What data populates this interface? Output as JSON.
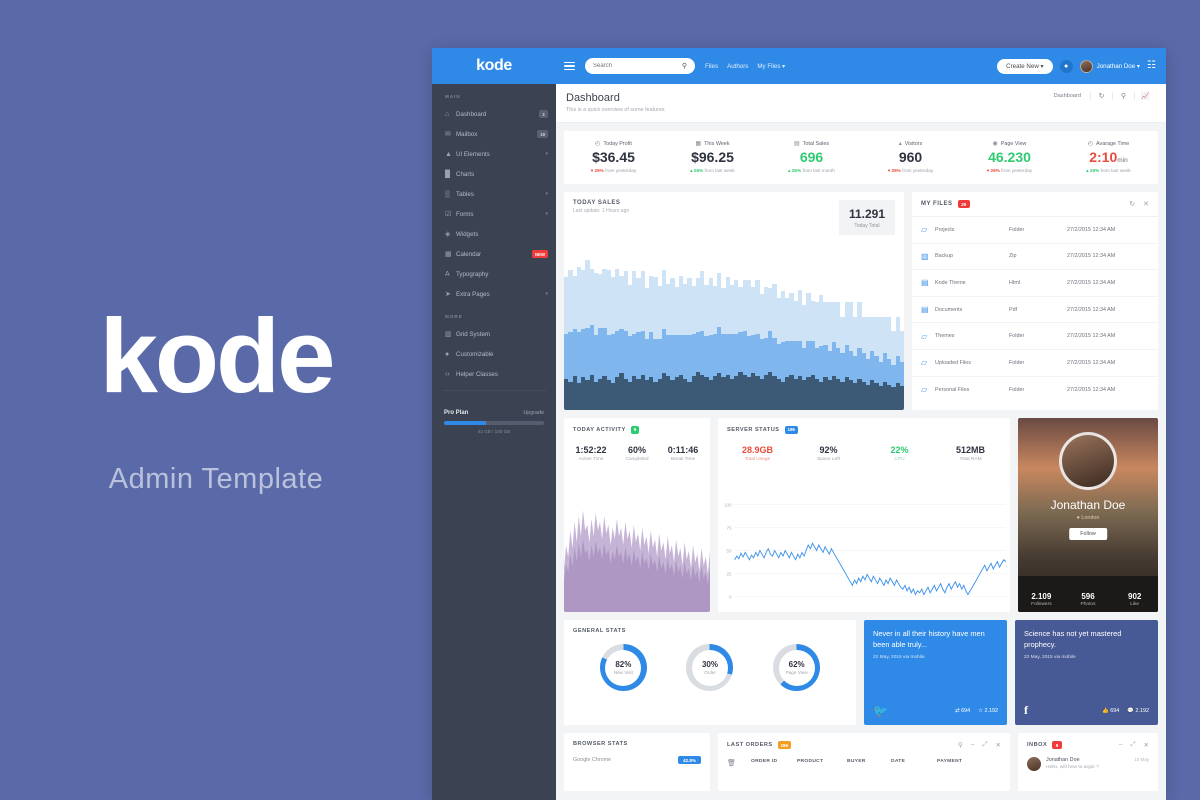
{
  "brand": {
    "logo": "kode",
    "tagline": "Admin Template",
    "accent": "#2e8ae6",
    "page_bg": "#5a6aa8"
  },
  "sidebar": {
    "logo": "kode",
    "section_main": "MAIN",
    "section_more": "MORE",
    "items_main": [
      {
        "label": "Dashboard",
        "icon": "home-icon",
        "badge": "3",
        "caret": ""
      },
      {
        "label": "Mailbox",
        "icon": "mail-icon",
        "badge": "19",
        "caret": ""
      },
      {
        "label": "UI Elements",
        "icon": "layers-icon",
        "badge": "",
        "caret": "▾"
      },
      {
        "label": "Charts",
        "icon": "chart-icon",
        "badge": "",
        "caret": ""
      },
      {
        "label": "Tables",
        "icon": "grid-icon",
        "badge": "",
        "caret": "▾"
      },
      {
        "label": "Forms",
        "icon": "form-icon",
        "badge": "",
        "caret": "▾"
      },
      {
        "label": "Widgets",
        "icon": "widget-icon",
        "badge": "",
        "caret": ""
      },
      {
        "label": "Calendar",
        "icon": "calendar-icon",
        "badge": "NEW",
        "caret": ""
      },
      {
        "label": "Typography",
        "icon": "type-icon",
        "badge": "",
        "caret": ""
      },
      {
        "label": "Extra Pages",
        "icon": "rocket-icon",
        "badge": "",
        "caret": "▾"
      }
    ],
    "items_more": [
      {
        "label": "Grid System",
        "icon": "columns-icon"
      },
      {
        "label": "Customizable",
        "icon": "bulb-icon"
      },
      {
        "label": "Helper Classes",
        "icon": "code-icon"
      }
    ],
    "plan": {
      "name": "Pro Plan",
      "upgrade": "Upgrade",
      "usage": "42 GB / 100 GB",
      "percent": 42
    }
  },
  "topbar": {
    "search_placeholder": "Search",
    "nav": [
      "Files",
      "Authors",
      "My Files ▾"
    ],
    "create_label": "Create New ▾",
    "user_name": "Jonathan Doe ▾"
  },
  "pagehead": {
    "title": "Dashboard",
    "subtitle": "This is a quick overview of some features",
    "breadcrumb": "Dashboard"
  },
  "stats": [
    {
      "label": "Today Profit",
      "icon": "clock-icon",
      "value": "$36.45",
      "unit": "",
      "color": "dark",
      "dir": "dn",
      "pct": "26%",
      "note": "from yesterday"
    },
    {
      "label": "This Week",
      "icon": "calendar-icon",
      "value": "$96.25",
      "unit": "",
      "color": "dark",
      "dir": "up",
      "pct": "26%",
      "note": "from last week"
    },
    {
      "label": "Total Sales",
      "icon": "cart-icon",
      "value": "696",
      "unit": "",
      "color": "green",
      "dir": "up",
      "pct": "26%",
      "note": "from last month"
    },
    {
      "label": "Visitors",
      "icon": "users-icon",
      "value": "960",
      "unit": "",
      "color": "dark",
      "dir": "dn",
      "pct": "26%",
      "note": "from yesterday"
    },
    {
      "label": "Page View",
      "icon": "eye-icon",
      "value": "46.230",
      "unit": "",
      "color": "green",
      "dir": "dn",
      "pct": "26%",
      "note": "from yesterday"
    },
    {
      "label": "Avarage Time",
      "icon": "clock-icon",
      "value": "2:10",
      "unit": "min",
      "color": "red",
      "dir": "up",
      "pct": "26%",
      "note": "from last week"
    }
  ],
  "today_sales": {
    "title": "TODAY SALES",
    "subtitle": "Last update: 1 Hours ago",
    "total": "11.291",
    "total_caption": "Today Total"
  },
  "my_files": {
    "title": "MY FILES",
    "badge": "29",
    "rows": [
      {
        "name": "Projects",
        "type": "Folder",
        "date": "27/2/2015 12:34 AM",
        "icon": "folder-icon"
      },
      {
        "name": "Backup",
        "type": "Zip",
        "date": "27/2/2015 12:34 AM",
        "icon": "zip-icon"
      },
      {
        "name": "Kode Theme",
        "type": "Html",
        "date": "27/2/2015 12:34 AM",
        "icon": "html-icon"
      },
      {
        "name": "Documents",
        "type": "Pdf",
        "date": "27/2/2015 12:34 AM",
        "icon": "pdf-icon"
      },
      {
        "name": "Themes",
        "type": "Folder",
        "date": "27/2/2015 12:34 AM",
        "icon": "folder-icon"
      },
      {
        "name": "Uploaded Files",
        "type": "Folder",
        "date": "27/2/2015 12:34 AM",
        "icon": "folder-icon"
      },
      {
        "name": "Personal Files",
        "type": "Folder",
        "date": "27/2/2015 12:34 AM",
        "icon": "folder-icon"
      }
    ]
  },
  "today_activity": {
    "title": "TODAY ACTIVITY",
    "badge": "9",
    "kpis": [
      {
        "value": "1:52:22",
        "caption": "Active Time"
      },
      {
        "value": "60%",
        "caption": "Completed"
      },
      {
        "value": "0:11:46",
        "caption": "Break Time"
      }
    ]
  },
  "server_status": {
    "title": "SERVER STATUS",
    "badge": "196",
    "kpis": [
      {
        "value": "28.9GB",
        "caption": "Total Usage",
        "color": "red"
      },
      {
        "value": "92%",
        "caption": "Space Left",
        "color": "dark"
      },
      {
        "value": "22%",
        "caption": "CPU",
        "color": "green"
      },
      {
        "value": "512MB",
        "caption": "Total RAM",
        "color": "dark"
      }
    ]
  },
  "profile": {
    "name": "Jonathan Doe",
    "location": "London",
    "follow_label": "Follow",
    "stats": [
      {
        "value": "2.109",
        "caption": "Followers"
      },
      {
        "value": "596",
        "caption": "Photos"
      },
      {
        "value": "902",
        "caption": "Like"
      }
    ]
  },
  "general_stats": {
    "title": "GENERAL STATS",
    "donuts": [
      {
        "percent": "82%",
        "caption": "New Visit",
        "value": 82,
        "color": "#2e8ae6"
      },
      {
        "percent": "30%",
        "caption": "Order",
        "value": 30,
        "color": "#2e8ae6"
      },
      {
        "percent": "62%",
        "caption": "Page View",
        "value": 62,
        "color": "#2e8ae6"
      }
    ]
  },
  "social": [
    {
      "network": "twitter",
      "quote": "Never in all their history have men been able truly...",
      "date": "22 May, 2015 via mobile",
      "m1": "694",
      "m2": "2.192",
      "color": "#2e8ae6"
    },
    {
      "network": "facebook",
      "quote": "Science has not yet mastered prophecy.",
      "date": "22 May, 2015 via mobile",
      "m1": "694",
      "m2": "2.192",
      "color": "#485a96"
    }
  ],
  "browser_stats": {
    "title": "BROWSER STATS",
    "rows": [
      {
        "name": "Google Chrome",
        "pct": "42.8%"
      }
    ]
  },
  "last_orders": {
    "title": "LAST ORDERS",
    "badge": "196",
    "columns": [
      "ORDER ID",
      "PRODUCT",
      "BUYER",
      "DATE",
      "PAYMENT"
    ]
  },
  "inbox": {
    "title": "INBOX",
    "badge": "9",
    "rows": [
      {
        "name": "Jonathan Doe",
        "msg": "Hello, will how to argin ?",
        "time": "10 May"
      }
    ]
  },
  "chart_data": [
    {
      "type": "bar",
      "title": "TODAY SALES",
      "ylabel": "",
      "xlabel": "",
      "stacked": true,
      "series": [
        {
          "name": "bottom",
          "color": "#3c5a75",
          "values": [
            22,
            20,
            24,
            19,
            23,
            21,
            25,
            20,
            22,
            24,
            21,
            19,
            23,
            26,
            22,
            20,
            24,
            22,
            25,
            21,
            23,
            20,
            22,
            26,
            24,
            21,
            23,
            25,
            22,
            20,
            24,
            27,
            25,
            23,
            21,
            24,
            26,
            23,
            25,
            22,
            24,
            27,
            25,
            23,
            26,
            24,
            22,
            25,
            27,
            24,
            22,
            20,
            23,
            25,
            22,
            24,
            21,
            23,
            25,
            22,
            20,
            23,
            21,
            24,
            22,
            20,
            23,
            21,
            19,
            22,
            20,
            18,
            21,
            19,
            17,
            20,
            18,
            16,
            19,
            17
          ]
        },
        {
          "name": "middle",
          "color": "#7fb6ed",
          "values": [
            32,
            35,
            33,
            36,
            34,
            37,
            35,
            33,
            36,
            34,
            32,
            35,
            33,
            31,
            34,
            32,
            30,
            33,
            31,
            29,
            32,
            30,
            28,
            31,
            29,
            32,
            30,
            28,
            31,
            33,
            30,
            28,
            31,
            29,
            32,
            30,
            33,
            31,
            29,
            32,
            30,
            28,
            31,
            29,
            27,
            30,
            28,
            26,
            29,
            27,
            25,
            28,
            26,
            24,
            27,
            25,
            23,
            26,
            24,
            22,
            25,
            23,
            21,
            24,
            22,
            20,
            23,
            21,
            19,
            22,
            20,
            18,
            21,
            19,
            17,
            20,
            18,
            16,
            19,
            17
          ]
        },
        {
          "name": "top",
          "color": "#cfe3f7",
          "values": [
            40,
            44,
            38,
            46,
            42,
            48,
            40,
            44,
            38,
            42,
            46,
            40,
            44,
            38,
            42,
            36,
            44,
            38,
            42,
            36,
            40,
            44,
            38,
            42,
            36,
            40,
            34,
            42,
            36,
            40,
            34,
            38,
            42,
            36,
            40,
            34,
            38,
            32,
            40,
            34,
            38,
            32,
            36,
            40,
            34,
            38,
            32,
            36,
            30,
            38,
            32,
            36,
            30,
            34,
            28,
            36,
            30,
            34,
            28,
            32,
            36,
            30,
            34,
            28,
            32,
            26,
            30,
            34,
            28,
            32,
            26,
            30,
            24,
            28,
            32,
            26,
            30,
            24,
            28,
            22
          ]
        }
      ],
      "legend": false,
      "grid": false
    },
    {
      "type": "area",
      "title": "TODAY ACTIVITY",
      "color": "#b39bc8",
      "values": [
        30,
        46,
        38,
        56,
        44,
        62,
        48,
        66,
        52,
        70,
        56,
        60,
        48,
        64,
        52,
        68,
        56,
        62,
        50,
        66,
        54,
        60,
        46,
        58,
        50,
        64,
        52,
        58,
        46,
        62,
        50,
        56,
        44,
        60,
        48,
        54,
        42,
        58,
        46,
        52,
        40,
        56,
        44,
        50,
        38,
        54,
        42,
        48,
        36,
        52,
        40,
        46,
        34,
        50,
        38,
        44,
        32,
        48,
        36,
        42,
        30,
        46,
        34,
        40,
        28,
        44,
        32,
        38,
        26,
        42
      ],
      "grid": false,
      "legend": false
    },
    {
      "type": "line",
      "title": "SERVER STATUS",
      "color": "#3f93e8",
      "ylim": [
        0,
        100
      ],
      "yticks": [
        0,
        25,
        50,
        75,
        100
      ],
      "grid": true,
      "legend": false,
      "values": [
        40,
        44,
        41,
        47,
        43,
        48,
        44,
        40,
        45,
        42,
        48,
        44,
        50,
        46,
        42,
        48,
        52,
        46,
        44,
        50,
        46,
        42,
        48,
        44,
        50,
        46,
        42,
        48,
        44,
        40,
        46,
        42,
        48,
        44,
        50,
        56,
        52,
        58,
        54,
        50,
        56,
        52,
        48,
        54,
        50,
        46,
        52,
        48,
        44,
        40,
        36,
        32,
        28,
        24,
        20,
        16,
        12,
        18,
        14,
        20,
        16,
        22,
        18,
        24,
        20,
        16,
        22,
        18,
        14,
        20,
        16,
        12,
        18,
        14,
        20,
        16,
        12,
        18,
        14,
        10,
        8,
        12,
        6,
        10,
        4,
        8,
        2,
        6,
        4,
        8,
        2,
        6,
        10,
        4,
        8,
        12,
        6,
        10,
        14,
        8,
        4,
        10,
        14,
        8,
        12,
        16,
        10,
        14,
        8,
        12,
        6,
        2,
        6,
        10,
        14,
        18,
        22,
        26,
        30,
        34,
        28,
        32,
        36,
        30,
        34,
        38,
        32,
        36,
        40,
        38
      ]
    }
  ]
}
